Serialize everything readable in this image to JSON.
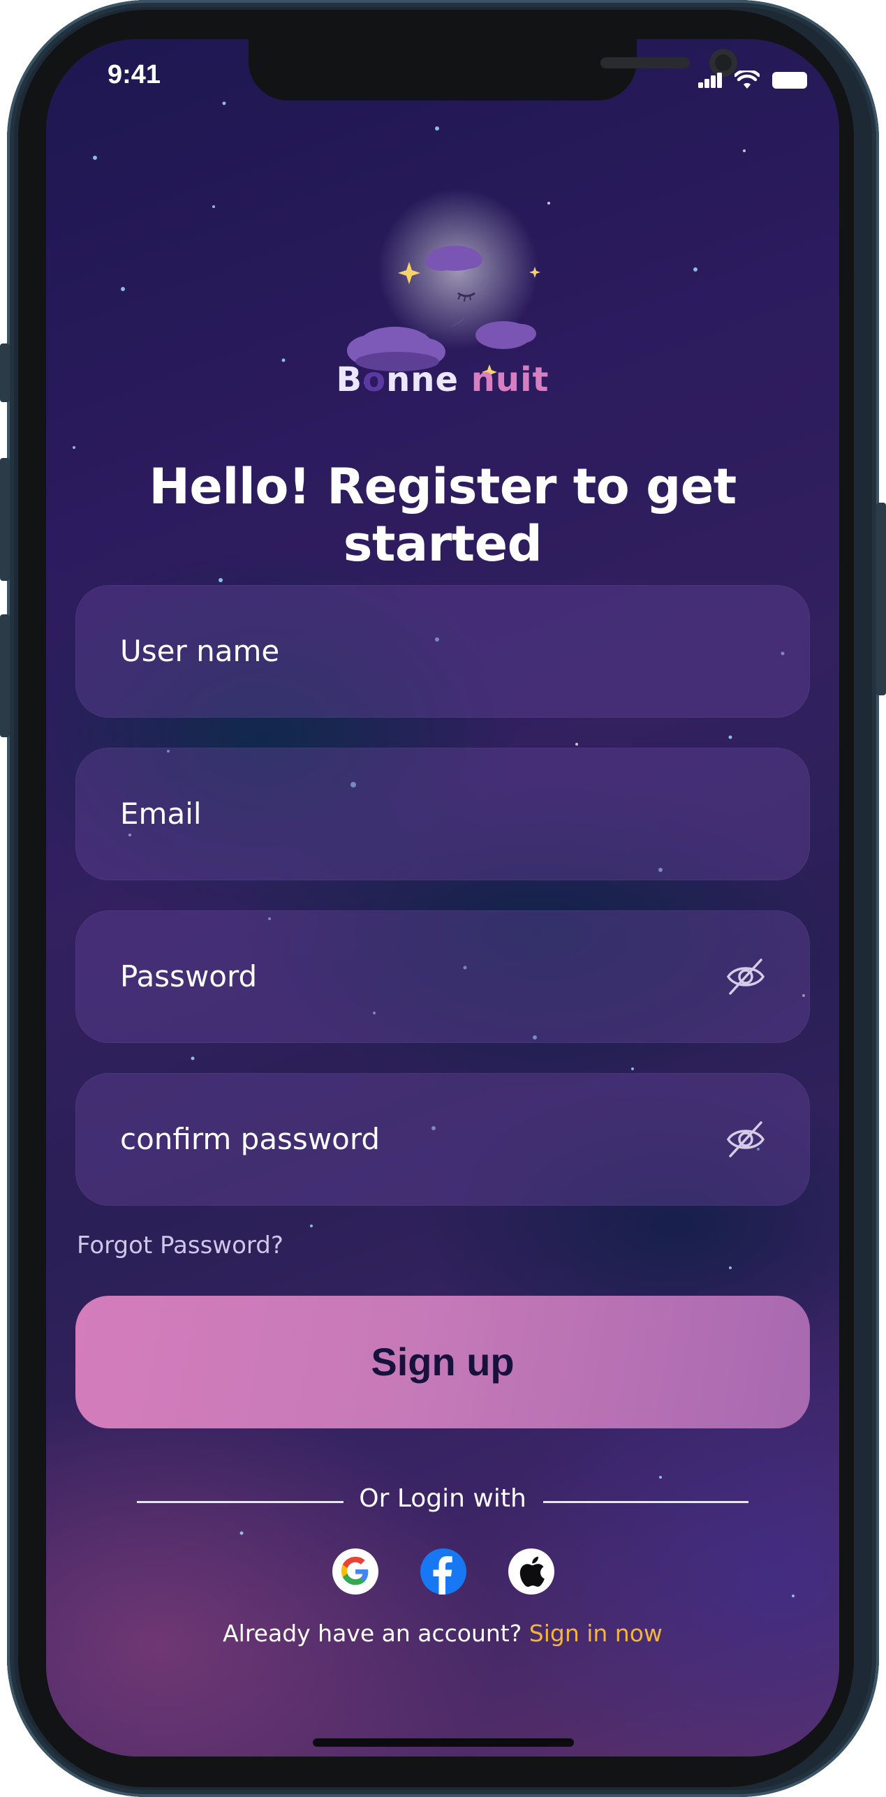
{
  "status_bar": {
    "time": "9:41",
    "icons": [
      "signal-icon",
      "wifi-icon",
      "battery-icon"
    ]
  },
  "brand": {
    "first_letter": "B",
    "o_letter": "o",
    "rest_first_word": "nne",
    "second_word": "nuit",
    "logo_icon": "sleeping-moon-icon"
  },
  "headline": "Hello! Register to get started",
  "form": {
    "username_placeholder": "User name",
    "email_placeholder": "Email",
    "password_placeholder": "Password",
    "confirm_password_placeholder": "confirm password",
    "forgot_password": "Forgot Password?",
    "submit_label": "Sign up"
  },
  "social_login": {
    "divider_text": "Or Login with",
    "providers": [
      "google-icon",
      "facebook-icon",
      "apple-icon"
    ]
  },
  "footer": {
    "prompt": "Already have an account?",
    "link": "Sign in now"
  },
  "colors": {
    "accent_pink": "#d47cbc",
    "link_yellow": "#f5b53a",
    "button_text": "#17123d"
  }
}
